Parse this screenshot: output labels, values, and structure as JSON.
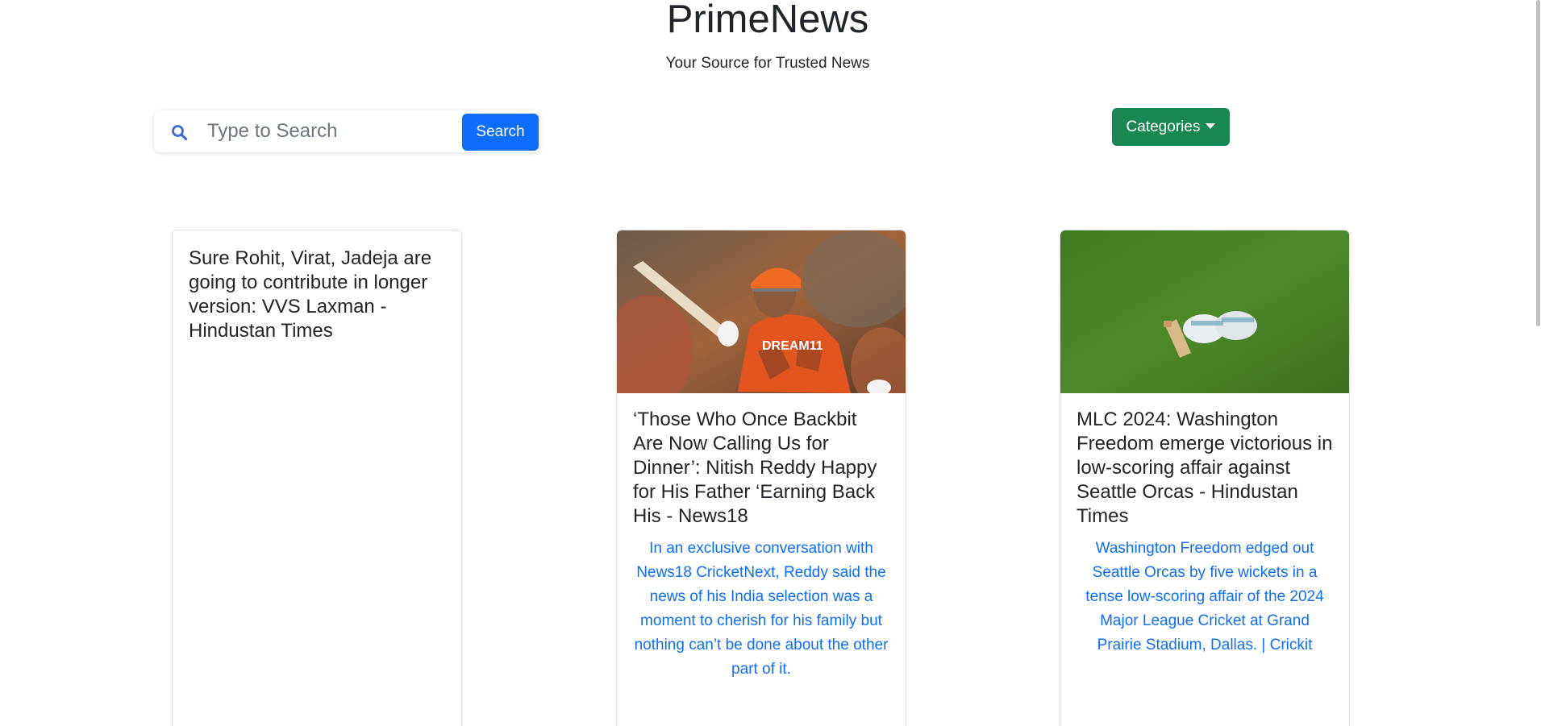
{
  "header": {
    "title": "PrimeNews",
    "tagline": "Your Source for Trusted News"
  },
  "search": {
    "placeholder": "Type to Search",
    "value": "",
    "button_label": "Search",
    "icon": "search-icon"
  },
  "categories": {
    "label": "Categories",
    "icon": "caret-down-icon"
  },
  "articles": [
    {
      "title": "Sure Rohit, Virat, Jadeja are going to contribute in longer version: VVS Laxman - Hindustan Times",
      "description": "",
      "has_image": false
    },
    {
      "title": "‘Those Who Once Backbit Are Now Calling Us for Dinner’: Nitish Reddy Happy for His Father ‘Earning Back His - News18",
      "description": "In an exclusive conversation with News18 CricketNext, Reddy said the news of his India selection was a moment to cherish for his family but nothing can’t be done about the other part of it.",
      "has_image": true,
      "image_alt": "cricketer in orange jersey raising bat"
    },
    {
      "title": "MLC 2024: Washington Freedom emerge victorious in low-scoring affair against Seattle Orcas - Hindustan Times",
      "description": "Washington Freedom edged out Seattle Orcas by five wickets in a tense low-scoring affair of the 2024 Major League Cricket at Grand Prairie Stadium, Dallas. | Crickit",
      "has_image": true,
      "image_alt": "cricket bat and gloves on grass"
    }
  ],
  "colors": {
    "primary": "#0d6efd",
    "success": "#198754",
    "text": "#212529",
    "link": "#0d6efd"
  }
}
